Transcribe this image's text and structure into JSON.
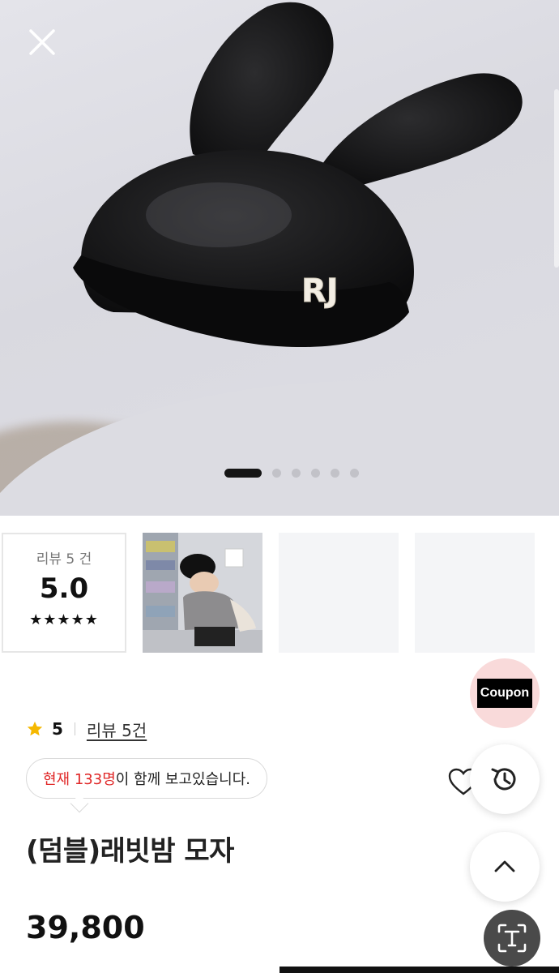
{
  "hero": {
    "hat_text": "RJ",
    "slides_total": 6,
    "slide_active_index": 0,
    "close_icon": "close-icon"
  },
  "reviews": {
    "label": "리뷰 5 건",
    "score": "5.0",
    "stars": "★★★★★"
  },
  "rating_line": {
    "rating": "5",
    "review_link": "리뷰 5건"
  },
  "viewers": {
    "highlight": "현재 133명",
    "rest": "이 함께 보고있습니다."
  },
  "product": {
    "title": "(덤블)래빗밤 모자",
    "price": "39,800"
  },
  "floating": {
    "coupon_label": "Coupon",
    "history_icon": "history-icon",
    "top_icon": "chevron-up-icon",
    "scan_icon": "text-scan-icon"
  },
  "colors": {
    "highlight_red": "#e02727",
    "coupon_bg": "#f9dada",
    "star_yellow": "#f5b800"
  }
}
